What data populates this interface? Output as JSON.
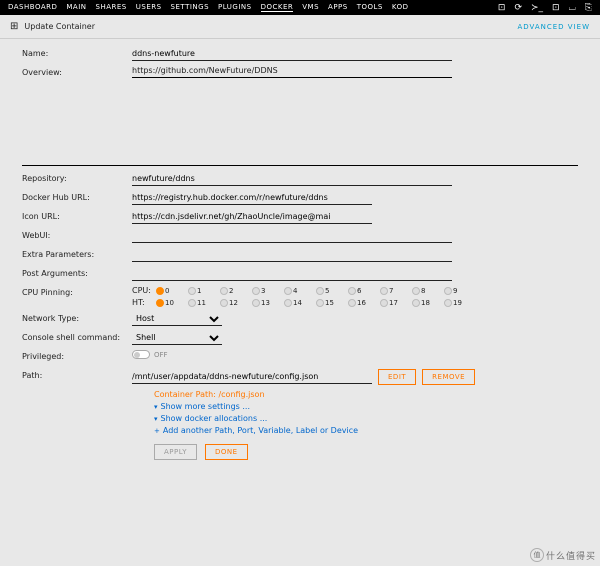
{
  "nav": [
    "DASHBOARD",
    "MAIN",
    "SHARES",
    "USERS",
    "SETTINGS",
    "PLUGINS",
    "DOCKER",
    "VMS",
    "APPS",
    "TOOLS",
    "KOD"
  ],
  "nav_active": "DOCKER",
  "title": "Update Container",
  "advanced": "ADVANCED VIEW",
  "labels": {
    "name": "Name:",
    "overview": "Overview:",
    "repo": "Repository:",
    "hub": "Docker Hub URL:",
    "icon": "Icon URL:",
    "web": "WebUI:",
    "extra": "Extra Parameters:",
    "post": "Post Arguments:",
    "cpu": "CPU Pinning:",
    "nettype": "Network Type:",
    "console": "Console shell command:",
    "priv": "Privileged:",
    "path": "Path:"
  },
  "fields": {
    "name": "ddns-newfuture",
    "overview": "https://github.com/NewFuture/DDNS",
    "repo": "newfuture/ddns",
    "hub": "https://registry.hub.docker.com/r/newfuture/ddns",
    "icon": "https://cdn.jsdelivr.net/gh/ZhaoUncle/image@mai",
    "web": "",
    "extra": "",
    "post": "",
    "path": "/mnt/user/appdata/ddns-newfuture/config.json"
  },
  "pins": {
    "cpu_label": "CPU:",
    "ht_label": "HT:",
    "row0": [
      0,
      1,
      2,
      3,
      4,
      5,
      6,
      7,
      8,
      9
    ],
    "row1": [
      10,
      11,
      12,
      13,
      14,
      15,
      16,
      17,
      18,
      19
    ],
    "selected": [
      0,
      10
    ]
  },
  "nettype": "Host",
  "console": "Shell",
  "priv_off": "OFF",
  "buttons": {
    "edit": "EDIT",
    "remove": "REMOVE",
    "apply": "APPLY",
    "done": "DONE"
  },
  "container_path": "Container Path: /config.json",
  "links": {
    "more": "Show more settings ...",
    "alloc": "Show docker allocations ...",
    "add": "Add another Path, Port, Variable, Label or Device"
  },
  "watermark": {
    "char": "值",
    "text": "什么值得买"
  }
}
